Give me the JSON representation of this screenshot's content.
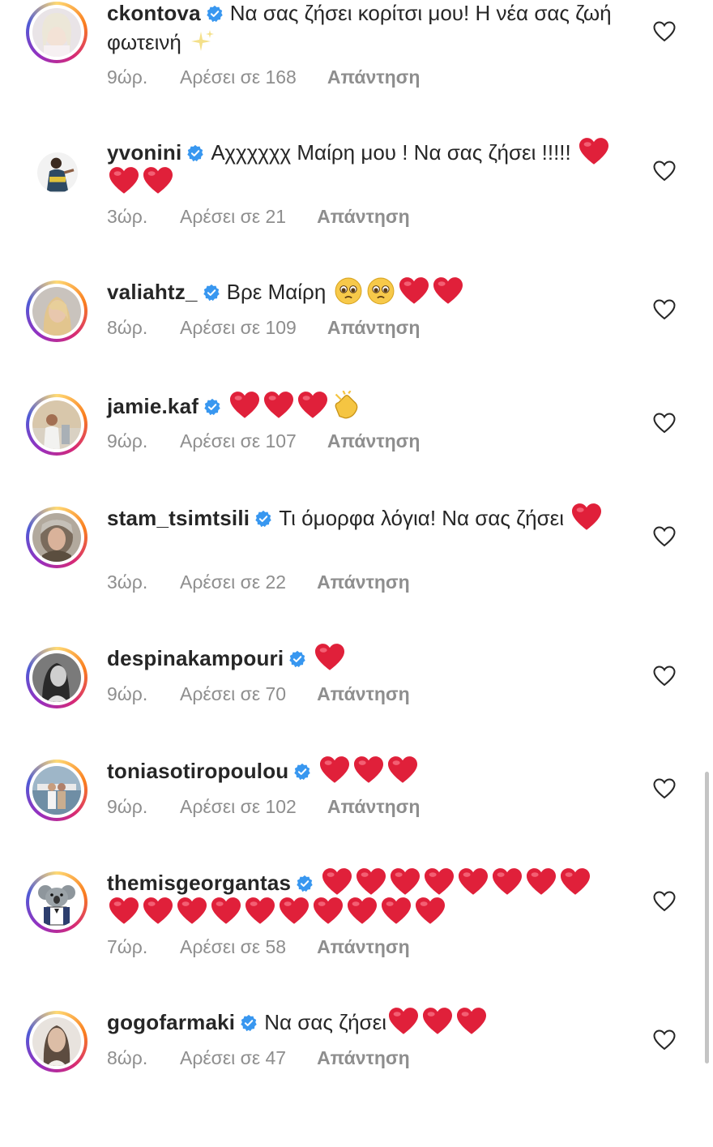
{
  "ui": {
    "like_count_prefix": "Αρέσει σε",
    "reply_label": "Απάντηση"
  },
  "colors": {
    "verified": "#3897f0",
    "meta": "#8e8e8e",
    "text": "#262626",
    "heart_emoji": "#e0203a"
  },
  "comments": [
    {
      "username": "ckontova",
      "verified": true,
      "text": "Να σας ζήσει κορίτσι μου! Η νέα σας ζωή φωτεινή ✨",
      "time": "9ώρ.",
      "likes": "168",
      "avatar": "woman-light-hair",
      "story_ring": true
    },
    {
      "username": "yvonini",
      "verified": true,
      "text": "Αχχχχχχ Μαίρη μου ! Να σας ζήσει !!!!! ❤️❤️❤️",
      "time": "3ώρ.",
      "likes": "21",
      "avatar": "woman-dark-outfit",
      "story_ring": false
    },
    {
      "username": "valiahtz_",
      "verified": true,
      "text": "Βρε Μαίρη 🥹🥹❤️❤️",
      "time": "8ώρ.",
      "likes": "109",
      "avatar": "woman-blonde",
      "story_ring": true
    },
    {
      "username": "jamie.kaf",
      "verified": true,
      "text": "❤️❤️❤️👏",
      "time": "9ώρ.",
      "likes": "107",
      "avatar": "man-beach",
      "story_ring": true
    },
    {
      "username": "stam_tsimtsili",
      "verified": true,
      "text": "Τι όμορφα λόγια! Να σας ζήσει ❤️",
      "time": "3ώρ.",
      "likes": "22",
      "avatar": "woman-headscarf",
      "story_ring": true
    },
    {
      "username": "despinakampouri",
      "verified": true,
      "text": "❤️",
      "time": "9ώρ.",
      "likes": "70",
      "avatar": "woman-black-white",
      "story_ring": true
    },
    {
      "username": "toniasotiropoulou",
      "verified": true,
      "text": "❤️❤️❤️",
      "time": "9ώρ.",
      "likes": "102",
      "avatar": "couple-harbor",
      "story_ring": true
    },
    {
      "username": "themisgeorgantas",
      "verified": true,
      "text": "❤️❤️❤️❤️❤️❤️❤️❤️❤️❤️❤️❤️❤️❤️❤️❤️❤️❤️",
      "time": "7ώρ.",
      "likes": "58",
      "avatar": "koala-cartoon",
      "story_ring": true
    },
    {
      "username": "gogofarmaki",
      "verified": true,
      "text": "Να σας ζήσει❤️❤️❤️",
      "time": "8ώρ.",
      "likes": "47",
      "avatar": "woman-portrait",
      "story_ring": true
    }
  ]
}
